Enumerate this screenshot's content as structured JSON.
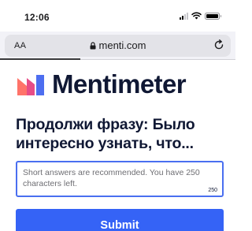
{
  "status_bar": {
    "time": "12:06",
    "icons": [
      "cellular-signal-icon",
      "wifi-icon",
      "battery-icon"
    ]
  },
  "browser": {
    "text_size_label": "AA",
    "url": "menti.com",
    "reload_icon": "reload-icon",
    "lock_icon": "lock-icon",
    "load_progress": 0.34
  },
  "logo": {
    "text": "Mentimeter",
    "colors": [
      "#ff7369",
      "#e74c87",
      "#4d6ef0"
    ]
  },
  "question": {
    "text": "Продолжи фразу: Было интересно узнать, что..."
  },
  "answer": {
    "placeholder": "Short answers are recommended. You have 250 characters left.",
    "value": "",
    "char_count": "250"
  },
  "submit": {
    "label": "Submit",
    "color": "#3563f6"
  }
}
